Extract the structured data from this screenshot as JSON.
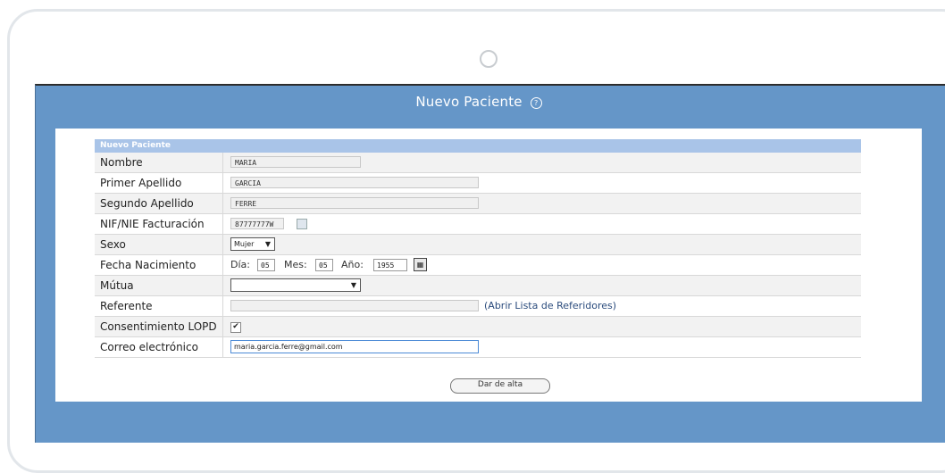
{
  "window": {
    "title": "Nuevo Paciente",
    "help_icon": "?"
  },
  "form": {
    "header": "Nuevo Paciente",
    "fields": {
      "nombre": {
        "label": "Nombre",
        "value": "MARIA"
      },
      "primer_apellido": {
        "label": "Primer Apellido",
        "value": "GARCIA"
      },
      "segundo_apellido": {
        "label": "Segundo Apellido",
        "value": "FERRE"
      },
      "nif": {
        "label": "NIF/NIE Facturación",
        "value": "87777777W"
      },
      "sexo": {
        "label": "Sexo",
        "value": "Mujer"
      },
      "fecha_nacimiento": {
        "label": "Fecha Nacimiento",
        "dia_label": "Día:",
        "dia": "05",
        "mes_label": "Mes:",
        "mes": "05",
        "anio_label": "Año:",
        "anio": "1955"
      },
      "mutua": {
        "label": "Mútua",
        "value": ""
      },
      "referente": {
        "label": "Referente",
        "value": "",
        "link": "(Abrir Lista de Referidores)"
      },
      "lopd": {
        "label": "Consentimiento LOPD",
        "checked": true,
        "mark": "✔"
      },
      "correo": {
        "label": "Correo electrónico",
        "value": "maria.garcia.ferre@gmail.com"
      }
    },
    "submit_label": "Dar de alta"
  },
  "colors": {
    "screen": "#6596c8",
    "header": "#a9c4e8",
    "link": "#2a4b7c"
  }
}
